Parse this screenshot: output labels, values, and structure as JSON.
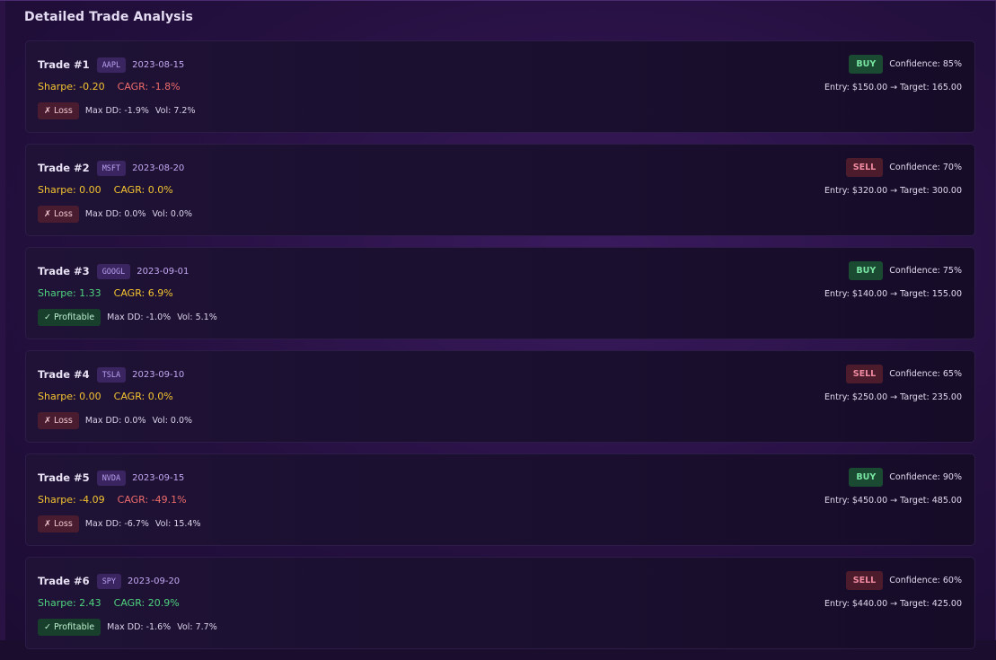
{
  "section": {
    "title": "Detailed Trade Analysis"
  },
  "trades": [
    {
      "label": "Trade #1",
      "symbol": "AAPL",
      "date": "2023-08-15",
      "sharpe": "Sharpe: -0.20",
      "sharpe_color": "yellow",
      "cagr": "CAGR: -1.8%",
      "cagr_color": "red",
      "status": "✗ Loss",
      "status_type": "loss",
      "max_dd": "Max DD: -1.9%",
      "vol": "Vol: 7.2%",
      "side": "BUY",
      "side_type": "buy",
      "confidence": "Confidence: 85%",
      "entry_target": "Entry: $150.00 → Target: 165.00"
    },
    {
      "label": "Trade #2",
      "symbol": "MSFT",
      "date": "2023-08-20",
      "sharpe": "Sharpe: 0.00",
      "sharpe_color": "yellow",
      "cagr": "CAGR: 0.0%",
      "cagr_color": "yellow",
      "status": "✗ Loss",
      "status_type": "loss",
      "max_dd": "Max DD: 0.0%",
      "vol": "Vol: 0.0%",
      "side": "SELL",
      "side_type": "sell",
      "confidence": "Confidence: 70%",
      "entry_target": "Entry: $320.00 → Target: 300.00"
    },
    {
      "label": "Trade #3",
      "symbol": "GOOGL",
      "date": "2023-09-01",
      "sharpe": "Sharpe: 1.33",
      "sharpe_color": "green",
      "cagr": "CAGR: 6.9%",
      "cagr_color": "yellow",
      "status": "✓ Profitable",
      "status_type": "profit",
      "max_dd": "Max DD: -1.0%",
      "vol": "Vol: 5.1%",
      "side": "BUY",
      "side_type": "buy",
      "confidence": "Confidence: 75%",
      "entry_target": "Entry: $140.00 → Target: 155.00"
    },
    {
      "label": "Trade #4",
      "symbol": "TSLA",
      "date": "2023-09-10",
      "sharpe": "Sharpe: 0.00",
      "sharpe_color": "yellow",
      "cagr": "CAGR: 0.0%",
      "cagr_color": "yellow",
      "status": "✗ Loss",
      "status_type": "loss",
      "max_dd": "Max DD: 0.0%",
      "vol": "Vol: 0.0%",
      "side": "SELL",
      "side_type": "sell",
      "confidence": "Confidence: 65%",
      "entry_target": "Entry: $250.00 → Target: 235.00"
    },
    {
      "label": "Trade #5",
      "symbol": "NVDA",
      "date": "2023-09-15",
      "sharpe": "Sharpe: -4.09",
      "sharpe_color": "yellow",
      "cagr": "CAGR: -49.1%",
      "cagr_color": "red",
      "status": "✗ Loss",
      "status_type": "loss",
      "max_dd": "Max DD: -6.7%",
      "vol": "Vol: 15.4%",
      "side": "BUY",
      "side_type": "buy",
      "confidence": "Confidence: 90%",
      "entry_target": "Entry: $450.00 → Target: 485.00"
    },
    {
      "label": "Trade #6",
      "symbol": "SPY",
      "date": "2023-09-20",
      "sharpe": "Sharpe: 2.43",
      "sharpe_color": "green",
      "cagr": "CAGR: 20.9%",
      "cagr_color": "green",
      "status": "✓ Profitable",
      "status_type": "profit",
      "max_dd": "Max DD: -1.6%",
      "vol": "Vol: 7.7%",
      "side": "SELL",
      "side_type": "sell",
      "confidence": "Confidence: 60%",
      "entry_target": "Entry: $440.00 → Target: 425.00"
    }
  ],
  "colors": {
    "yellow": "#f4c430",
    "red": "#ee6b6b",
    "green": "#4fd37e",
    "buy_bg": "#1b4a33",
    "sell_bg": "#4d1c2c"
  }
}
